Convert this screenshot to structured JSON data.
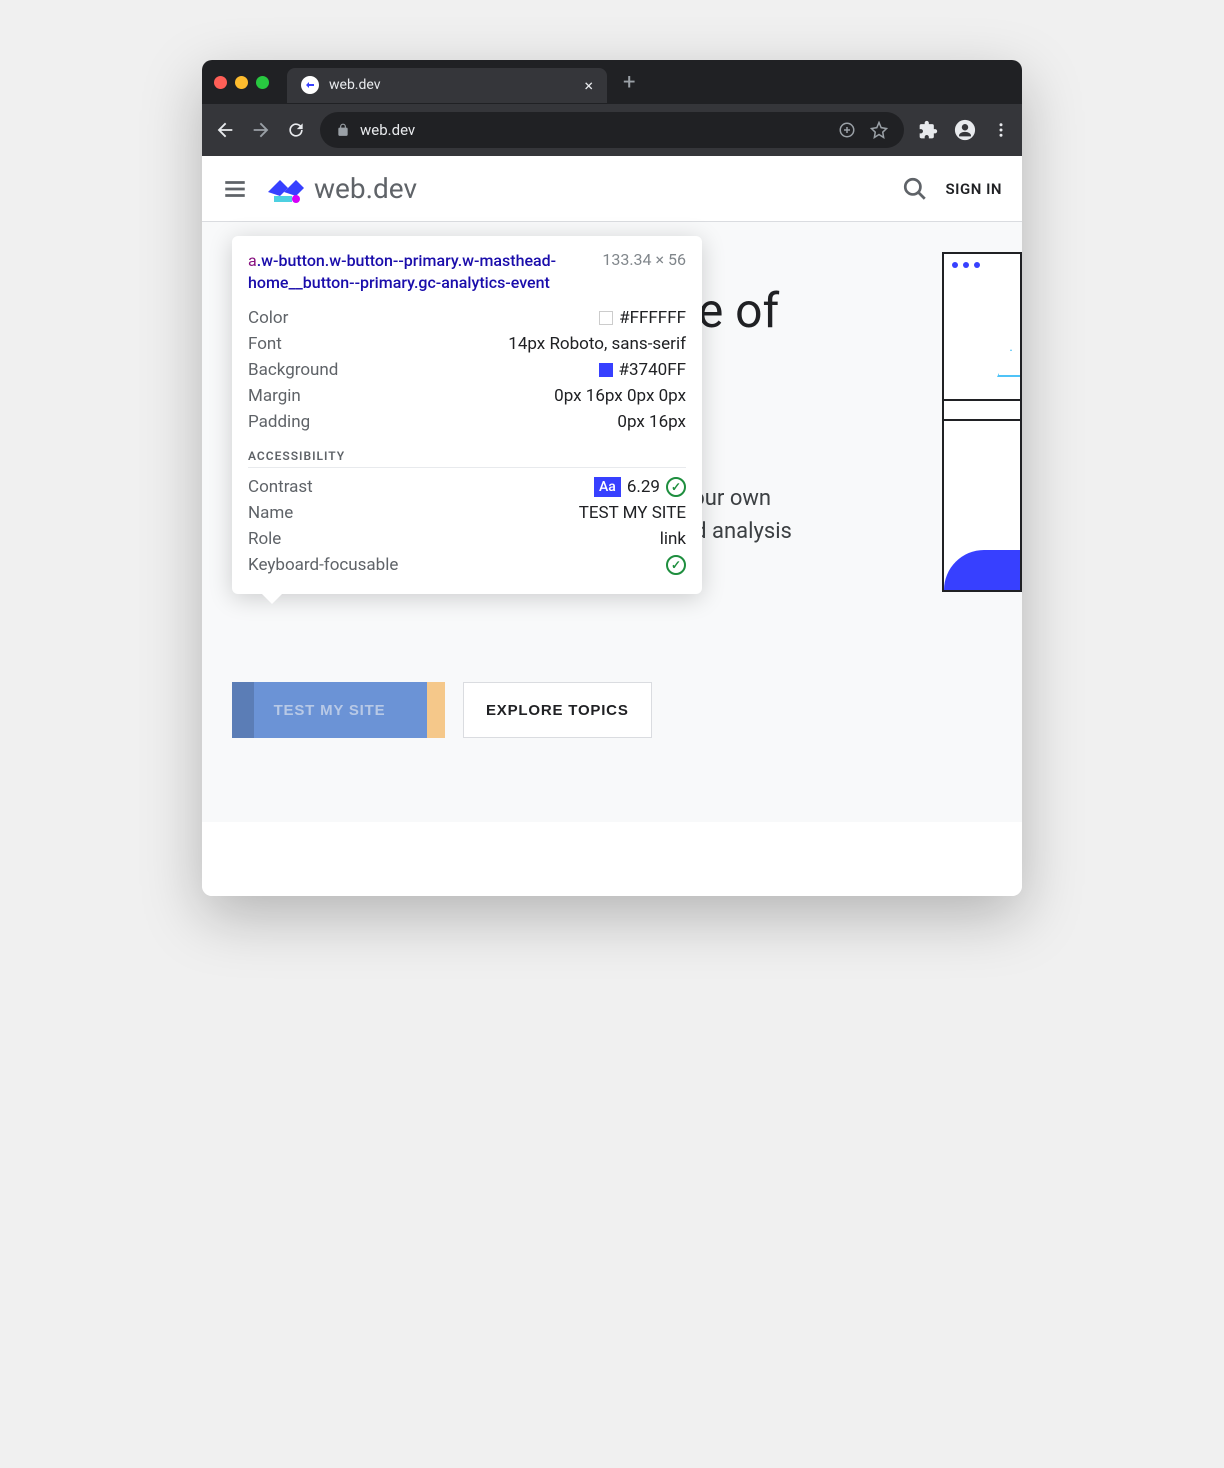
{
  "browser": {
    "tab_title": "web.dev",
    "url": "web.dev"
  },
  "site": {
    "logo_text": "web.dev",
    "signin": "SIGN IN"
  },
  "hero": {
    "title_fragment": "re of",
    "body_line1": "your own",
    "body_line2": "nd analysis",
    "test_button": "TEST MY SITE",
    "explore_button": "EXPLORE TOPICS"
  },
  "tooltip": {
    "tag": "a",
    "selector": ".w-button.w-button--primary.w-masthead-home__button--primary.gc-analytics-event",
    "dims": "133.34 × 56",
    "rows": {
      "color_label": "Color",
      "color_value": "#FFFFFF",
      "font_label": "Font",
      "font_value": "14px Roboto, sans-serif",
      "bg_label": "Background",
      "bg_value": "#3740FF",
      "margin_label": "Margin",
      "margin_value": "0px 16px 0px 0px",
      "padding_label": "Padding",
      "padding_value": "0px 16px"
    },
    "section": "ACCESSIBILITY",
    "a11y": {
      "contrast_label": "Contrast",
      "contrast_badge": "Aa",
      "contrast_value": "6.29",
      "name_label": "Name",
      "name_value": "TEST MY SITE",
      "role_label": "Role",
      "role_value": "link",
      "kb_label": "Keyboard-focusable"
    }
  }
}
